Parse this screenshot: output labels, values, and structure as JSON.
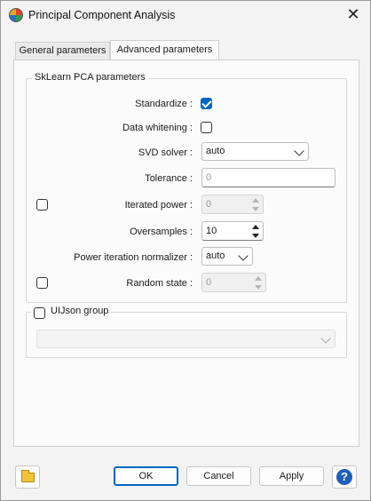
{
  "window": {
    "title": "Principal Component Analysis",
    "close_glyph": "✕",
    "app_icon": "pca-app-icon"
  },
  "tabs": [
    {
      "label": "General parameters",
      "selected": false
    },
    {
      "label": "Advanced parameters",
      "selected": true
    }
  ],
  "sklearn_group": {
    "title": "SkLearn PCA parameters",
    "standardize": {
      "label": "Standardize :",
      "checked": true
    },
    "data_whitening": {
      "label": "Data whitening :",
      "checked": false
    },
    "svd_solver": {
      "label": "SVD solver :",
      "value": "auto"
    },
    "tolerance": {
      "label": "Tolerance :",
      "placeholder": "0"
    },
    "iterated_power": {
      "label": "Iterated power :",
      "enabled": false,
      "value": "0"
    },
    "oversamples": {
      "label": "Oversamples :",
      "value": "10"
    },
    "power_iteration_normalizer": {
      "label": "Power iteration normalizer :",
      "value": "auto"
    },
    "random_state": {
      "label": "Random state :",
      "enabled": false,
      "value": "0"
    }
  },
  "uijson_group": {
    "title": "UIJson group",
    "checked": false,
    "combo_value": ""
  },
  "buttons": {
    "ok": "OK",
    "cancel": "Cancel",
    "apply": "Apply",
    "help_glyph": "?"
  },
  "colors": {
    "accent": "#0067c0",
    "help": "#1f5fb9"
  }
}
